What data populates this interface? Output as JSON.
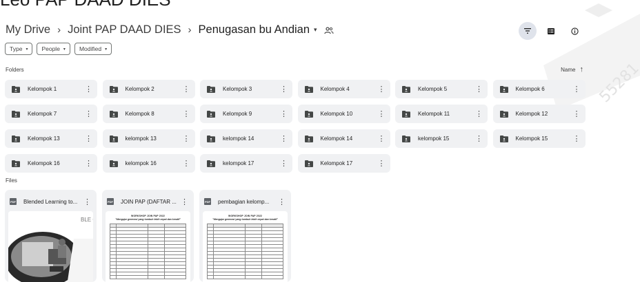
{
  "header": {
    "cut_title": "Leo PAP DAAD DIES"
  },
  "breadcrumb": {
    "root": "My Drive",
    "sep": "›",
    "parent": "Joint PAP DAAD DIES",
    "current": "Penugasan bu Andian",
    "caret": "▾"
  },
  "top_actions": {
    "filter_icon": "filter-icon",
    "view_icon": "list-view-icon",
    "info_icon": "info-icon"
  },
  "filters": {
    "type": "Type",
    "people": "People",
    "modified": "Modified",
    "dropdown_glyph": "▾"
  },
  "sections": {
    "folders_label": "Folders",
    "files_label": "Files"
  },
  "sort": {
    "label": "Name",
    "arrow": "↑"
  },
  "folders": [
    "Kelompok 1",
    "Kelompok 2",
    "Kelompok 3",
    "Kelompok 4",
    "Kelompok 5",
    "Kelompok 6",
    "Kelompok 7",
    "Kelompok 8",
    "Kelompok 9",
    "Kelompok 10",
    "Kelompok 11",
    "Kelompok 12",
    "Kelompok 13",
    "kelompok 13",
    "kelompok 14",
    "Kelompok 14",
    "kelompok 15",
    "Kelompok 15",
    "Kelompok 16",
    "kelompok 16",
    "kelompok 17",
    "Kelompok 17"
  ],
  "files": [
    {
      "name": "Blended Learning to...",
      "thumb": "photo",
      "thumb_text": "BLE CA"
    },
    {
      "name": "JOIN PAP (DAFTAR ...",
      "thumb": "document",
      "doc_title": "WORKSHOP JOIN PAP 2022",
      "doc_sub": "\"Mengajar generasi yang tumbuh lebih cepat dan kreatif\""
    },
    {
      "name": "pembagian kelomp...",
      "thumb": "document",
      "doc_title": "WORKSHOP JOIN PAP 2022",
      "doc_sub": "\"Mengajar generasi yang tumbuh lebih cepat dan kreatif\""
    }
  ],
  "more_glyph": "⋮",
  "pdf_badge": "PDF",
  "colors": {
    "folder_bg": "#f0f1f3",
    "filter_active": "#dfe3eb",
    "text": "#1f1f1f"
  }
}
